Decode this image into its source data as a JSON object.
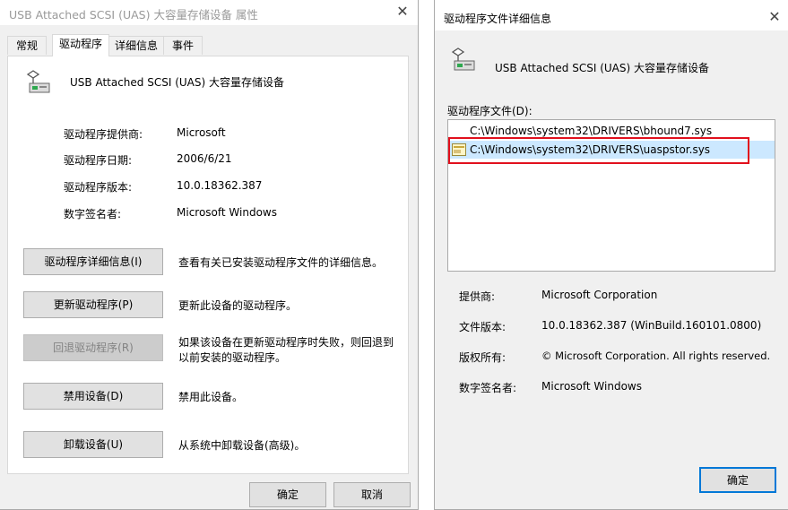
{
  "left_window": {
    "title": "USB Attached SCSI (UAS) 大容量存储设备 属性",
    "tabs": [
      "常规",
      "驱动程序",
      "详细信息",
      "事件"
    ],
    "device_name": "USB Attached SCSI (UAS) 大容量存储设备",
    "properties": [
      {
        "label": "驱动程序提供商:",
        "value": "Microsoft"
      },
      {
        "label": "驱动程序日期:",
        "value": "2006/6/21"
      },
      {
        "label": "驱动程序版本:",
        "value": "10.0.18362.387"
      },
      {
        "label": "数字签名者:",
        "value": "Microsoft Windows"
      }
    ],
    "actions": [
      {
        "button": "驱动程序详细信息(I)",
        "desc": "查看有关已安装驱动程序文件的详细信息。"
      },
      {
        "button": "更新驱动程序(P)",
        "desc": "更新此设备的驱动程序。"
      },
      {
        "button": "回退驱动程序(R)",
        "desc": "如果该设备在更新驱动程序时失败，则回退到以前安装的驱动程序。"
      },
      {
        "button": "禁用设备(D)",
        "desc": "禁用此设备。"
      },
      {
        "button": "卸载设备(U)",
        "desc": "从系统中卸载设备(高级)。"
      }
    ],
    "ok_label": "确定",
    "cancel_label": "取消"
  },
  "right_window": {
    "title": "驱动程序文件详细信息",
    "device_name": "USB Attached SCSI (UAS) 大容量存储设备",
    "files_label": "驱动程序文件(D):",
    "files": [
      "C:\\Windows\\system32\\DRIVERS\\bhound7.sys",
      "C:\\Windows\\system32\\DRIVERS\\uaspstor.sys"
    ],
    "details": [
      {
        "label": "提供商:",
        "value": "Microsoft Corporation"
      },
      {
        "label": "文件版本:",
        "value": "10.0.18362.387 (WinBuild.160101.0800)"
      },
      {
        "label": "版权所有:",
        "value": "© Microsoft Corporation. All rights reserved."
      },
      {
        "label": "数字签名者:",
        "value": "Microsoft Windows"
      }
    ],
    "ok_label": "确定"
  },
  "icons": {
    "close": "close-icon",
    "device": "usb-drive-icon",
    "file": "driver-file-icon"
  },
  "colors": {
    "highlight_border": "#e1101d",
    "selection": "#cce8ff",
    "default_button_border": "#0078d7"
  }
}
